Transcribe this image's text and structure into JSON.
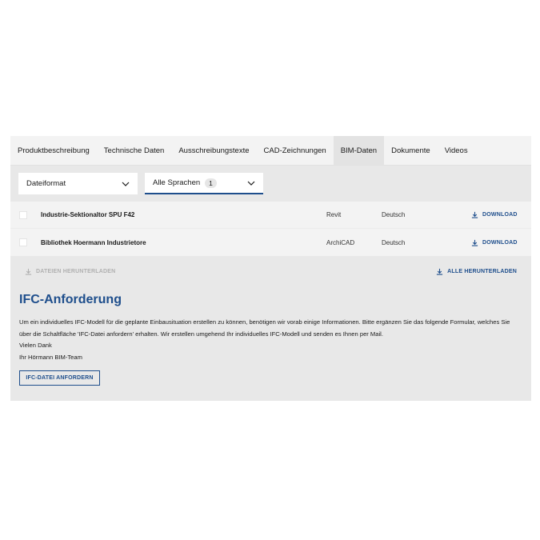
{
  "tabs": [
    {
      "label": "Produktbeschreibung",
      "active": false
    },
    {
      "label": "Technische Daten",
      "active": false
    },
    {
      "label": "Ausschreibungstexte",
      "active": false
    },
    {
      "label": "CAD-Zeichnungen",
      "active": false
    },
    {
      "label": "BIM-Daten",
      "active": true
    },
    {
      "label": "Dokumente",
      "active": false
    },
    {
      "label": "Videos",
      "active": false
    }
  ],
  "filters": {
    "format_label": "Dateiformat",
    "language_label": "Alle Sprachen",
    "language_count": "1"
  },
  "files": [
    {
      "name": "Industrie-Sektionaltor SPU F42",
      "type": "Revit",
      "language": "Deutsch",
      "download": "DOWNLOAD"
    },
    {
      "name": "Bibliothek Hoermann Industrietore",
      "type": "ArchiCAD",
      "language": "Deutsch",
      "download": "DOWNLOAD"
    }
  ],
  "actions": {
    "download_files": "DATEIEN HERUNTERLADEN",
    "download_all": "ALLE HERUNTERLADEN"
  },
  "ifc": {
    "title": "IFC-Anforderung",
    "body_line1": "Um ein individuelles IFC-Modell für die geplante Einbausituation erstellen zu können, benötigen wir vorab einige Informationen. Bitte ergänzen Sie das folgende Formular, welches Sie",
    "body_line2": "über die Schaltfläche 'IFC-Datei anfordern' erhalten. Wir erstellen umgehend Ihr individuelles IFC-Modell und senden es Ihnen per Mail.",
    "thanks": "Vielen Dank",
    "signature": "Ihr Hörmann BIM-Team",
    "button_label": "IFC-DATEI ANFORDERN"
  },
  "colors": {
    "accent": "#1e4e8c",
    "panel_bg": "#e8e8e8",
    "tabbar_bg": "#f3f3f3"
  }
}
